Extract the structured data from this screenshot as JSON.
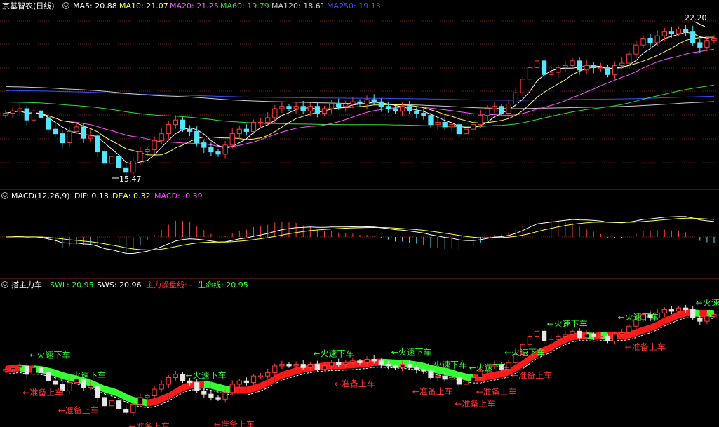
{
  "colors": {
    "background": "#000000",
    "divider": "#a01e1e",
    "grid": "#7a1f1f",
    "up": "#ff3c3c",
    "down": "#54e5ff",
    "ma5": "#ffffff",
    "ma10": "#ffff55",
    "ma20": "#ff55ff",
    "ma60": "#33dd33",
    "ma120": "#cccccc",
    "ma250": "#3355ff",
    "dif": "#ffffff",
    "dea": "#ffff44",
    "macd": "#ff44ff",
    "band_green": "#33ff33",
    "band_red": "#ff1a1a",
    "band_yellow": "#d4d400",
    "ann_green": "#33ff33",
    "ann_red": "#ff3333",
    "text_white": "#ffffff"
  },
  "header_main": {
    "stock_title": "京基智农(日线)",
    "ma5": "MA5: 20.88",
    "ma10": "MA10: 21.07",
    "ma20": "MA20: 21.25",
    "ma60": "MA60: 19.79",
    "ma120": "MA120: 18.61",
    "ma250": "MA250: 19.13"
  },
  "header_macd": {
    "title": "MACD(12,26,9)",
    "dif": "DIF: 0.13",
    "dea": "DEA: 0.32",
    "macd": "MACD: -0.39"
  },
  "header_zhuli": {
    "title": "搭主力车",
    "swl": "SWL: 20.95",
    "sws": "SWS: 20.96",
    "zhuli": "主力操盘线: -",
    "shengming": "生命线: 20.95"
  },
  "price_labels": {
    "high": "22.20",
    "low": "15.47"
  },
  "annotations": {
    "fast_exit": "火速下车",
    "prepare_enter": "准备上车"
  },
  "chart_data": [
    {
      "type": "candlestick",
      "title": "京基智农(日线)",
      "series": [
        {
          "name": "MA5",
          "last": 20.88
        },
        {
          "name": "MA10",
          "last": 21.07
        },
        {
          "name": "MA20",
          "last": 21.25
        },
        {
          "name": "MA60",
          "last": 19.79
        },
        {
          "name": "MA120",
          "last": 18.61
        },
        {
          "name": "MA250",
          "last": 19.13
        }
      ],
      "close": [
        18.3,
        18.4,
        18.5,
        18.0,
        18.4,
        18.1,
        17.6,
        17.4,
        17.0,
        17.5,
        17.7,
        17.2,
        17.3,
        16.6,
        16.1,
        16.4,
        15.9,
        15.7,
        16.2,
        16.6,
        16.7,
        17.1,
        17.4,
        17.8,
        18.0,
        17.6,
        17.5,
        17.0,
        16.8,
        16.6,
        16.5,
        16.9,
        17.4,
        17.6,
        17.5,
        17.9,
        17.9,
        18.1,
        18.5,
        18.6,
        18.5,
        18.6,
        18.4,
        18.6,
        18.3,
        18.5,
        18.7,
        18.6,
        18.7,
        18.8,
        18.7,
        18.9,
        18.8,
        18.6,
        18.5,
        18.4,
        18.6,
        18.4,
        18.3,
        18.2,
        17.8,
        17.9,
        17.7,
        17.8,
        17.4,
        17.6,
        17.8,
        18.2,
        18.5,
        18.6,
        18.3,
        18.7,
        19.2,
        19.8,
        20.3,
        20.6,
        20.0,
        20.1,
        20.3,
        20.4,
        20.6,
        20.2,
        20.4,
        20.3,
        20.3,
        20.0,
        20.4,
        20.5,
        20.9,
        21.3,
        21.6,
        21.4,
        21.7,
        21.9,
        21.8,
        22.0,
        21.9,
        21.4,
        21.2,
        21.5,
        21.6
      ],
      "annotations": [
        "22.20",
        "15.47"
      ]
    },
    {
      "type": "line",
      "title": "MACD(12,26,9)",
      "series": [
        {
          "name": "DIF",
          "last": 0.13
        },
        {
          "name": "DEA",
          "last": 0.32
        },
        {
          "name": "MACD",
          "last": -0.39
        }
      ]
    },
    {
      "type": "area",
      "title": "搭主力车",
      "series": [
        {
          "name": "SWL",
          "last": 20.95
        },
        {
          "name": "SWS",
          "last": 20.96
        },
        {
          "name": "主力操盘线",
          "last": "-"
        },
        {
          "name": "生命线",
          "last": 20.95
        }
      ],
      "annotations": [
        "火速下车",
        "准备上车"
      ]
    }
  ]
}
